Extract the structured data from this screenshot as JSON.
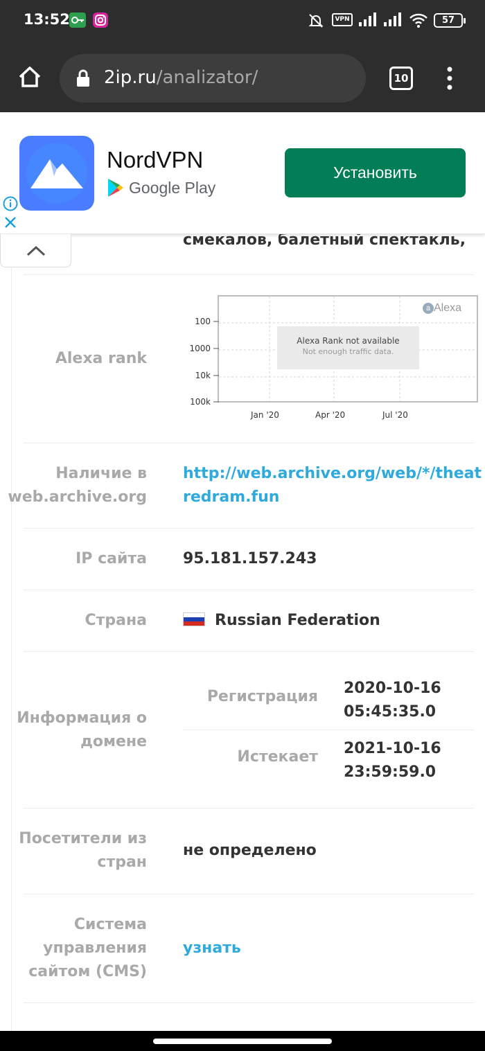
{
  "status_bar": {
    "time": "13:52",
    "vpn_label": "VPN",
    "battery": "57"
  },
  "browser": {
    "url_host": "2ip.ru",
    "url_path": "/analizator/",
    "tab_count": "10"
  },
  "ad": {
    "app_name": "NordVPN",
    "store_name": "Google Play",
    "install_label": "Установить"
  },
  "content": {
    "partial_text": "смекалов, балетный спектакль,",
    "alexa": {
      "label": "Alexa rank",
      "logo_text": "Alexa",
      "message_title": "Alexa Rank not available",
      "message_sub": "Not enough traffic data.",
      "y_ticks": [
        "100",
        "1000",
        "10k",
        "100k"
      ],
      "x_ticks": [
        "Jan '20",
        "Apr '20",
        "Jul '20"
      ]
    },
    "archive": {
      "label": "Наличие в web.archive.org",
      "value_line1": "http://web.archive.org/web/*/theat",
      "value_line2": "redram.fun"
    },
    "ip": {
      "label": "IP сайта",
      "value": "95.181.157.243"
    },
    "country": {
      "label": "Страна",
      "value": "Russian Federation"
    },
    "domain": {
      "label": "Информация о домене",
      "registration_label": "Регистрация",
      "registration_date": "2020-10-16",
      "registration_time": "05:45:35.0",
      "expires_label": "Истекает",
      "expires_date": "2021-10-16",
      "expires_time": "23:59:59.0"
    },
    "visitors": {
      "label": "Посетители из стран",
      "value": "не определено"
    },
    "cms": {
      "label": "Система управления сайтом  (CMS)",
      "value": "узнать"
    }
  }
}
